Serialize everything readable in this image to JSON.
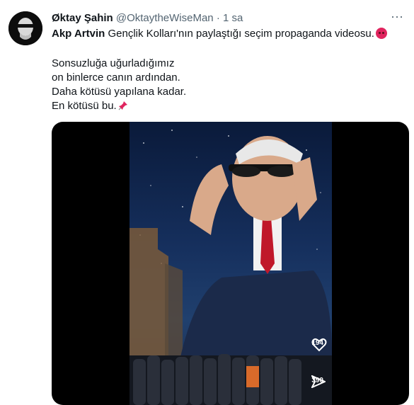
{
  "tweet": {
    "author_name": "Øktay Şahin",
    "handle": "@OktaytheWiseMan",
    "separator": "·",
    "time": "1 sa",
    "more_label": "···",
    "mention": "Akp Artvin",
    "line1_text": " Gençlik Kolları'nın  paylaştığı seçim propaganda videosu.",
    "lines": [
      "Sonsuzluğa uğurladığımız",
      "on binlerce canın ardından.",
      "Daha kötüsü yapılana kadar.",
      "En kötüsü bu."
    ]
  },
  "video": {
    "like_count": "194",
    "share_count": "390"
  },
  "icons": {
    "avatar": "avatar-face-icon",
    "angry": "angry-face-emoji-icon",
    "pin": "pushpin-emoji-icon",
    "like": "heart-icon",
    "share": "send-icon"
  },
  "colors": {
    "secondary_text": "#536471",
    "primary_text": "#0f1419",
    "angry_emoji": "#e0245e",
    "pin_emoji": "#e0245e"
  }
}
